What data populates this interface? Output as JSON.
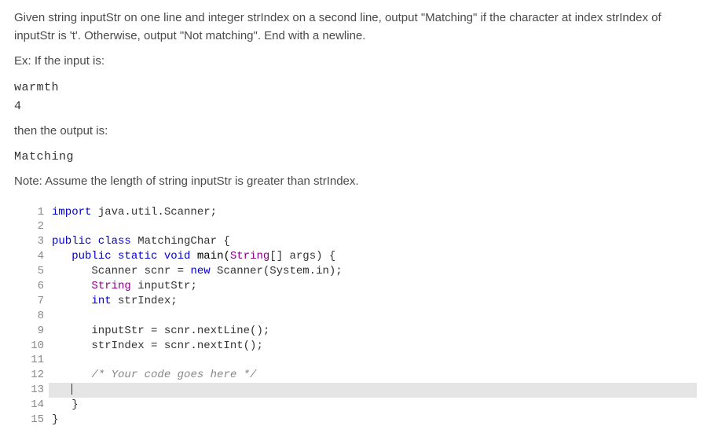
{
  "problem": {
    "description_line1": "Given string inputStr on one line and integer strIndex on a second line, output \"Matching\" if the character at index strIndex of",
    "description_line2": "inputStr is 't'. Otherwise, output \"Not matching\". End with a newline.",
    "example_intro": "Ex: If the input is:",
    "example_input_line1": "warmth",
    "example_input_line2": "4",
    "example_then": "then the output is:",
    "example_output": "Matching",
    "note": "Note: Assume the length of string inputStr is greater than strIndex."
  },
  "code": {
    "lines": [
      {
        "n": "1",
        "highlight": false,
        "segments": [
          {
            "t": "import ",
            "c": "kw"
          },
          {
            "t": "java.util.Scanner;",
            "c": ""
          }
        ]
      },
      {
        "n": "2",
        "highlight": false,
        "segments": [
          {
            "t": "",
            "c": ""
          }
        ]
      },
      {
        "n": "3",
        "highlight": false,
        "segments": [
          {
            "t": "public class ",
            "c": "kw"
          },
          {
            "t": "MatchingChar {",
            "c": ""
          }
        ]
      },
      {
        "n": "4",
        "highlight": false,
        "segments": [
          {
            "t": "   ",
            "c": ""
          },
          {
            "t": "public static void ",
            "c": "kw"
          },
          {
            "t": "main(",
            "c": "fn"
          },
          {
            "t": "String",
            "c": "typ"
          },
          {
            "t": "[] args) {",
            "c": ""
          }
        ]
      },
      {
        "n": "5",
        "highlight": false,
        "segments": [
          {
            "t": "      Scanner scnr = ",
            "c": ""
          },
          {
            "t": "new ",
            "c": "kw"
          },
          {
            "t": "Scanner(System.in);",
            "c": ""
          }
        ]
      },
      {
        "n": "6",
        "highlight": false,
        "segments": [
          {
            "t": "      ",
            "c": ""
          },
          {
            "t": "String ",
            "c": "typ"
          },
          {
            "t": "inputStr;",
            "c": ""
          }
        ]
      },
      {
        "n": "7",
        "highlight": false,
        "segments": [
          {
            "t": "      ",
            "c": ""
          },
          {
            "t": "int ",
            "c": "kw"
          },
          {
            "t": "strIndex;",
            "c": ""
          }
        ]
      },
      {
        "n": "8",
        "highlight": false,
        "segments": [
          {
            "t": "",
            "c": ""
          }
        ]
      },
      {
        "n": "9",
        "highlight": false,
        "segments": [
          {
            "t": "      inputStr = scnr.nextLine();",
            "c": ""
          }
        ]
      },
      {
        "n": "10",
        "highlight": false,
        "segments": [
          {
            "t": "      strIndex = scnr.nextInt();",
            "c": ""
          }
        ]
      },
      {
        "n": "11",
        "highlight": false,
        "segments": [
          {
            "t": "",
            "c": ""
          }
        ]
      },
      {
        "n": "12",
        "highlight": false,
        "segments": [
          {
            "t": "      ",
            "c": ""
          },
          {
            "t": "/* Your code goes here */",
            "c": "com"
          }
        ]
      },
      {
        "n": "13",
        "highlight": true,
        "cursor": true,
        "segments": [
          {
            "t": "   ",
            "c": ""
          }
        ]
      },
      {
        "n": "14",
        "highlight": false,
        "segments": [
          {
            "t": "   }",
            "c": ""
          }
        ]
      },
      {
        "n": "15",
        "highlight": false,
        "segments": [
          {
            "t": "}",
            "c": ""
          }
        ]
      }
    ]
  }
}
